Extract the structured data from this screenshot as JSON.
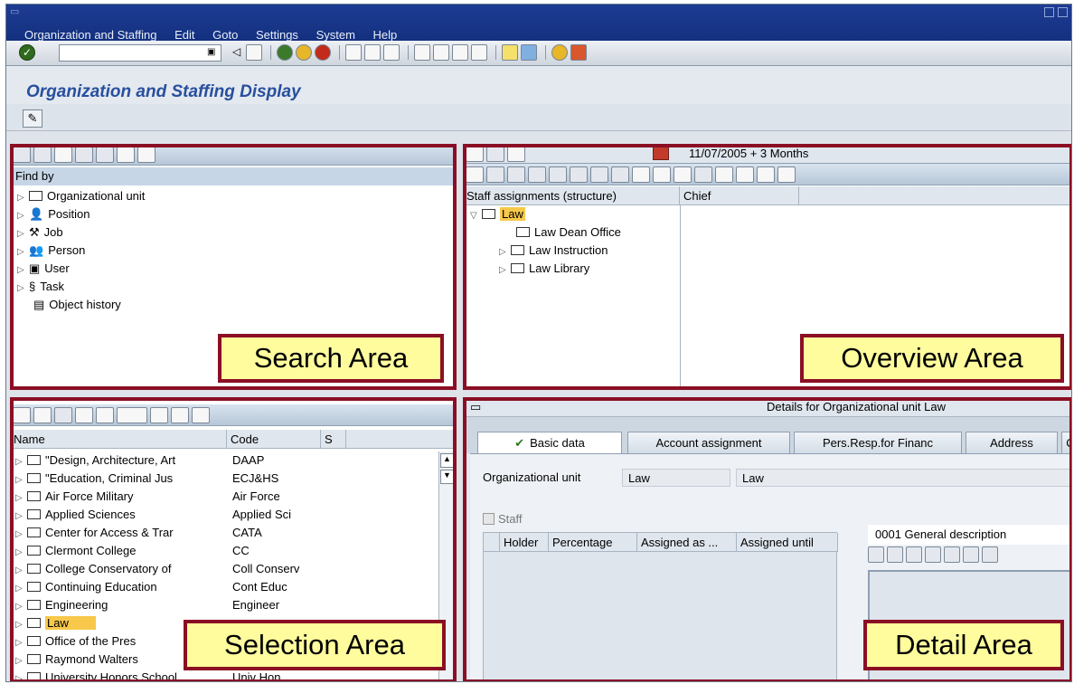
{
  "menubar": {
    "items": [
      "Organization and Staffing",
      "Edit",
      "Goto",
      "Settings",
      "System",
      "Help"
    ]
  },
  "page": {
    "title": "Organization and Staffing Display"
  },
  "search_area": {
    "find_by_label": "Find by",
    "items": [
      "Organizational unit",
      "Position",
      "Job",
      "Person",
      "User",
      "Task",
      "Object history"
    ],
    "callout": "Search Area"
  },
  "overview_area": {
    "date_label": "11/07/2005  + 3 Months",
    "columns": [
      "Staff assignments (structure)",
      "Chief"
    ],
    "root": "Law",
    "children": [
      "Law Dean Office",
      "Law Instruction",
      "Law Library"
    ],
    "callout": "Overview Area"
  },
  "selection_area": {
    "columns": [
      "Name",
      "Code",
      "S"
    ],
    "rows": [
      {
        "name": "\"Design, Architecture, Art",
        "code": "DAAP"
      },
      {
        "name": "\"Education, Criminal Jus",
        "code": "ECJ&HS"
      },
      {
        "name": "Air Force Military",
        "code": "Air Force"
      },
      {
        "name": "Applied Sciences",
        "code": "Applied Sci"
      },
      {
        "name": "Center for Access & Trar",
        "code": "CATA"
      },
      {
        "name": "Clermont College",
        "code": "CC"
      },
      {
        "name": "College  Conservatory of",
        "code": "Coll Conserv"
      },
      {
        "name": "Continuing Education",
        "code": "Cont Educ"
      },
      {
        "name": "Engineering",
        "code": "Engineer"
      },
      {
        "name": "Law",
        "code": ""
      },
      {
        "name": "Office of the Pres",
        "code": ""
      },
      {
        "name": "Raymond Walters",
        "code": ""
      },
      {
        "name": "University Honors School",
        "code": "Univ Hon"
      }
    ],
    "selected_row": "Law",
    "callout": "Selection Area"
  },
  "detail_area": {
    "header": "Details for Organizational unit Law",
    "tabs": [
      "Basic data",
      "Account assignment",
      "Pers.Resp.for Financ",
      "Address",
      "C"
    ],
    "org_unit_label": "Organizational unit",
    "org_unit_short": "Law",
    "org_unit_long": "Law",
    "staff_label": "Staff",
    "staff_columns": [
      "Holder",
      "Percentage",
      "Assigned as ...",
      "Assigned until"
    ],
    "description_label": "0001 General description",
    "callout": "Detail Area"
  },
  "colors": {
    "highlight_frame": "#8b0f24",
    "callout_fill": "#fefc9d",
    "title_blue": "#274f9e",
    "selected_row": "#f7c84a"
  }
}
